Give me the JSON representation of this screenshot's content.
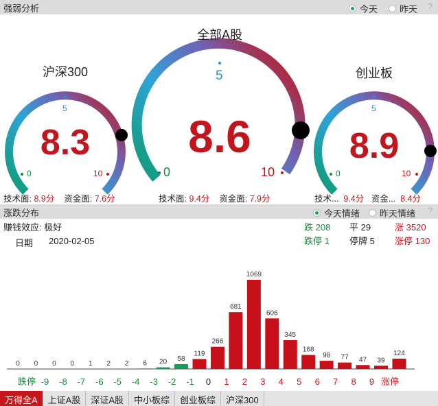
{
  "panel1": {
    "title": "强弱分析",
    "radio_today": "今天",
    "radio_yesterday": "昨天",
    "help": "?"
  },
  "gauges": [
    {
      "title": "沪深300",
      "value": "8.3",
      "min": "0",
      "mid": "5",
      "max": "10",
      "tech_label": "技术面:",
      "tech_value": "8.9分",
      "fund_label": "资金面:",
      "fund_value": "7.6分"
    },
    {
      "title": "全部A股",
      "value": "8.6",
      "min": "0",
      "mid": "5",
      "max": "10",
      "tech_label": "技术面:",
      "tech_value": "9.4分",
      "fund_label": "资金面:",
      "fund_value": "7.9分"
    },
    {
      "title": "创业板",
      "value": "8.9",
      "min": "0",
      "mid": "5",
      "max": "10",
      "tech_label": "技术...",
      "tech_value": "9.4分",
      "fund_label": "资金...",
      "fund_value": "8.4分"
    }
  ],
  "panel2": {
    "title": "涨跌分布",
    "radio_today": "今天情绪",
    "radio_yesterday": "昨天情绪",
    "help": "?",
    "effect_label": "赚钱效应:",
    "effect_value": "极好",
    "date_label": "日期",
    "date_value": "2020-02-05",
    "fall_label": "跌",
    "fall_value": "208",
    "flat_label": "平",
    "flat_value": "29",
    "rise_label": "涨",
    "rise_value": "3520",
    "limit_down_label": "跌停",
    "limit_down_value": "1",
    "halt_label": "停牌",
    "halt_value": "5",
    "limit_up_label": "涨停",
    "limit_up_value": "130"
  },
  "chart_data": {
    "type": "bar",
    "categories": [
      "跌停",
      "-9",
      "-8",
      "-7",
      "-6",
      "-5",
      "-4",
      "-3",
      "-2",
      "-1",
      "0",
      "1",
      "2",
      "3",
      "4",
      "5",
      "6",
      "7",
      "8",
      "9",
      "涨停"
    ],
    "values": [
      0,
      0,
      0,
      0,
      1,
      2,
      2,
      6,
      20,
      58,
      119,
      266,
      681,
      1069,
      606,
      345,
      168,
      98,
      77,
      47,
      39,
      124
    ],
    "colors": {
      "down": "#1a9a5a",
      "flat": "#1a9a5a",
      "up": "#c8101a"
    }
  },
  "tabs": [
    "万得全A",
    "上证A股",
    "深证A股",
    "中小板综",
    "创业板综",
    "沪深300"
  ]
}
